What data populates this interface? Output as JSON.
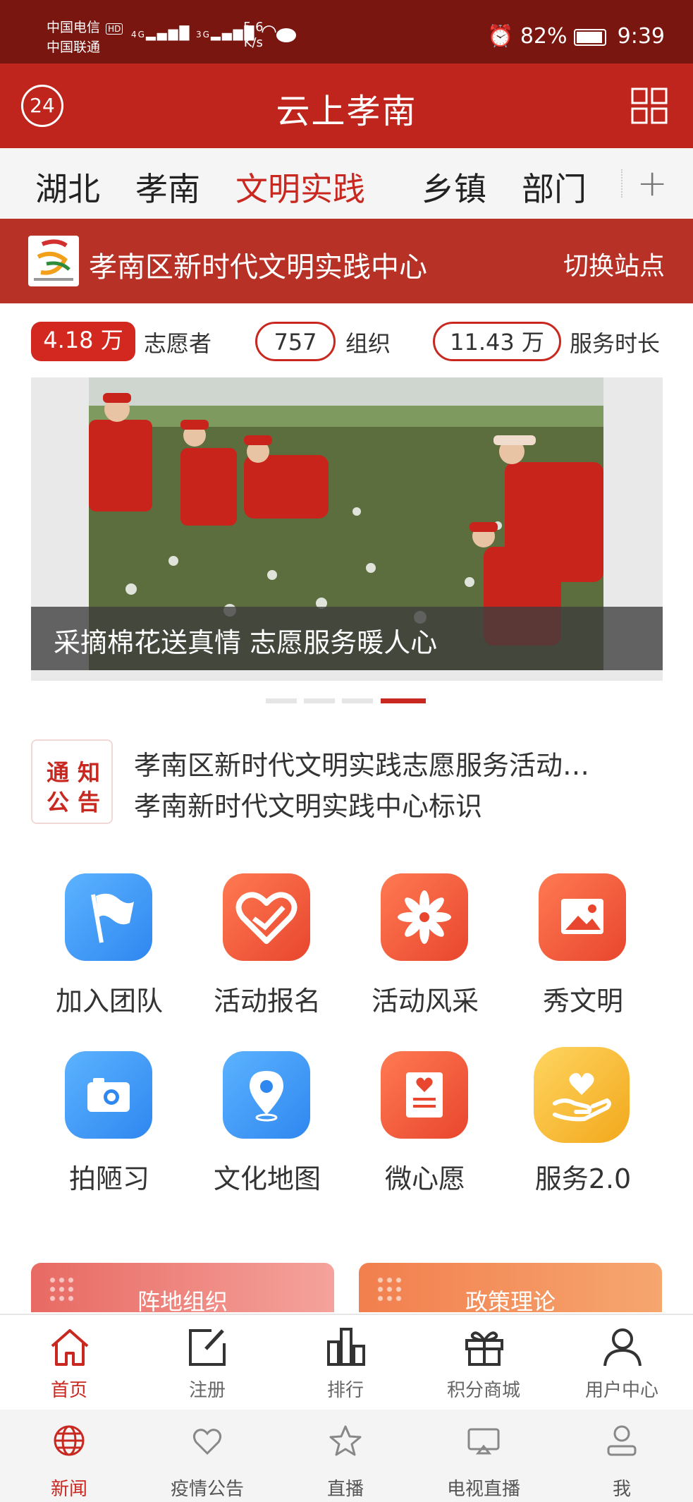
{
  "status_bar": {
    "carrier1": "中国电信",
    "carrier1_badge": "HD",
    "carrier2": "中国联通",
    "net1": "4G",
    "net2": "3G",
    "speed_value": "5.6",
    "speed_unit": "K/s",
    "battery": "82%",
    "time": "9:39"
  },
  "header": {
    "badge": "24",
    "title": "云上孝南"
  },
  "tabs": [
    {
      "label": "湖北"
    },
    {
      "label": "孝南"
    },
    {
      "label": "文明实践",
      "active": true
    },
    {
      "label": "乡镇"
    },
    {
      "label": "部门"
    }
  ],
  "station": {
    "name": "孝南区新时代文明实践中心",
    "switch_label": "切换站点"
  },
  "stats": [
    {
      "value": "4.18 万",
      "label": "志愿者"
    },
    {
      "value": "757",
      "label": "组织"
    },
    {
      "value": "11.43 万",
      "label": "服务时长"
    }
  ],
  "banner": {
    "caption": "采摘棉花送真情 志愿服务暖人心",
    "active_index": 3,
    "count": 4
  },
  "notice": {
    "badge_line1": "通知",
    "badge_line2": "公告",
    "items": [
      "孝南区新时代文明实践志愿服务活动…",
      "孝南新时代文明实践中心标识"
    ]
  },
  "icons": [
    {
      "label": "加入团队",
      "icon": "flag-icon",
      "color": "blue"
    },
    {
      "label": "活动报名",
      "icon": "heart-hand-icon",
      "color": "orange"
    },
    {
      "label": "活动风采",
      "icon": "flower-icon",
      "color": "orange"
    },
    {
      "label": "秀文明",
      "icon": "image-icon",
      "color": "orange"
    },
    {
      "label": "拍陋习",
      "icon": "camera-icon",
      "color": "blue"
    },
    {
      "label": "文化地图",
      "icon": "map-pin-icon",
      "color": "blue"
    },
    {
      "label": "微心愿",
      "icon": "wish-card-icon",
      "color": "orange"
    },
    {
      "label": "服务2.0",
      "icon": "heart-in-hand-icon",
      "color": "yellow"
    }
  ],
  "promo_cards": [
    {
      "label": "阵地组织"
    },
    {
      "label": "政策理论"
    }
  ],
  "inner_nav": [
    {
      "label": "首页",
      "icon": "home-icon",
      "active": true
    },
    {
      "label": "注册",
      "icon": "edit-icon"
    },
    {
      "label": "排行",
      "icon": "bar-chart-icon"
    },
    {
      "label": "积分商城",
      "icon": "gift-icon"
    },
    {
      "label": "用户中心",
      "icon": "user-icon"
    }
  ],
  "outer_nav": [
    {
      "label": "新闻",
      "icon": "globe-icon",
      "active": true
    },
    {
      "label": "疫情公告",
      "icon": "heart-icon"
    },
    {
      "label": "直播",
      "icon": "star-icon"
    },
    {
      "label": "电视直播",
      "icon": "tv-icon"
    },
    {
      "label": "我",
      "icon": "person-icon"
    }
  ],
  "colors": {
    "brand_red": "#bf251d",
    "status_bar": "#7a1610",
    "accent_blue": "#2f87f0",
    "accent_orange": "#e8462e"
  }
}
